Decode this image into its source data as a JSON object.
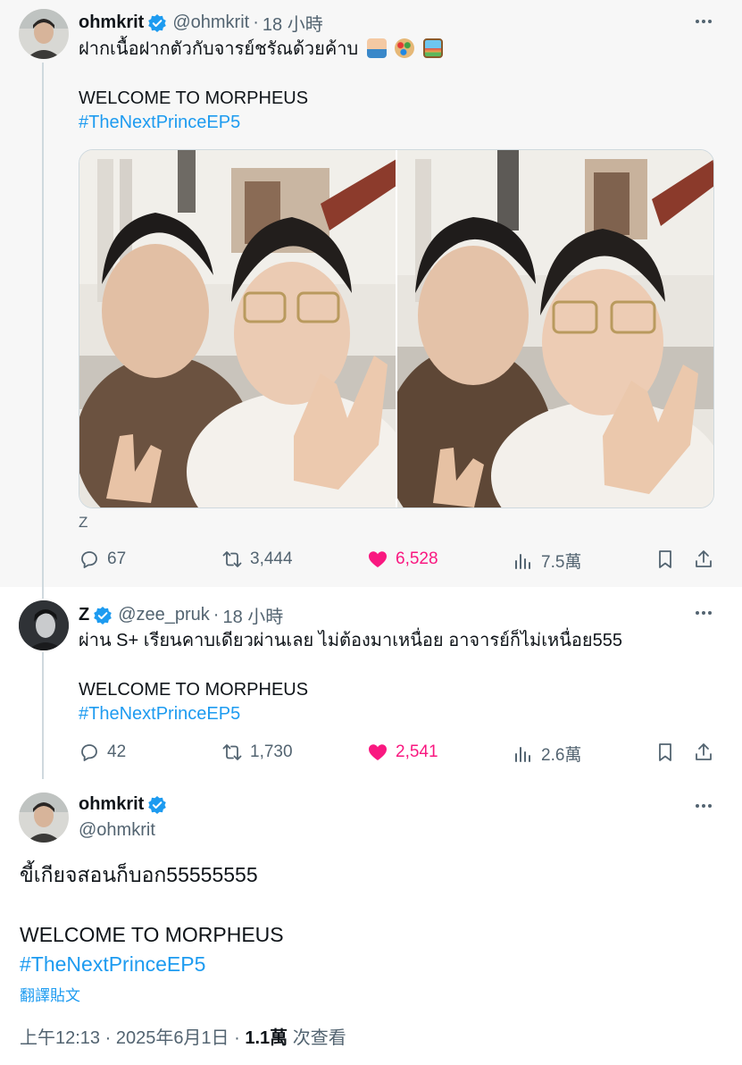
{
  "tweet1": {
    "name": "ohmkrit",
    "handle": "@ohmkrit",
    "time": "18 小時",
    "text": "ฝากเนื้อฝากตัวกับจารย์ชรัณด้วยค้าบ",
    "line2": "WELCOME TO MORPHEUS",
    "hashtag": "#TheNextPrinceEP5",
    "caption": "Z",
    "replies": "67",
    "reposts": "3,444",
    "likes": "6,528",
    "views": "7.5萬"
  },
  "tweet2": {
    "name": "Z",
    "handle": "@zee_pruk",
    "time": "18 小時",
    "text": "ผ่าน S+ เรียนคาบเดียวผ่านเลย ไม่ต้องมาเหนื่อย อาจารย์ก็ไม่เหนื่อย555",
    "line2": "WELCOME TO MORPHEUS",
    "hashtag": "#TheNextPrinceEP5",
    "replies": "42",
    "reposts": "1,730",
    "likes": "2,541",
    "views": "2.6萬"
  },
  "main": {
    "name": "ohmkrit",
    "handle": "@ohmkrit",
    "text": "ขี้เกียจสอนก็บอก55555555",
    "line2": "WELCOME TO MORPHEUS",
    "hashtag": "#TheNextPrinceEP5",
    "translate": "翻譯貼文",
    "timestamp": "上午12:13 · 2025年6月1日 · ",
    "views_count": "1.1萬",
    "views_label": " 次查看"
  },
  "colors": {
    "accent": "#1d9bf0",
    "like": "#f91880",
    "secondary_text": "#536471"
  },
  "icons": [
    "more-icon",
    "verified-badge-icon",
    "reply-icon",
    "repost-icon",
    "like-icon",
    "views-icon",
    "bookmark-icon",
    "share-icon"
  ]
}
